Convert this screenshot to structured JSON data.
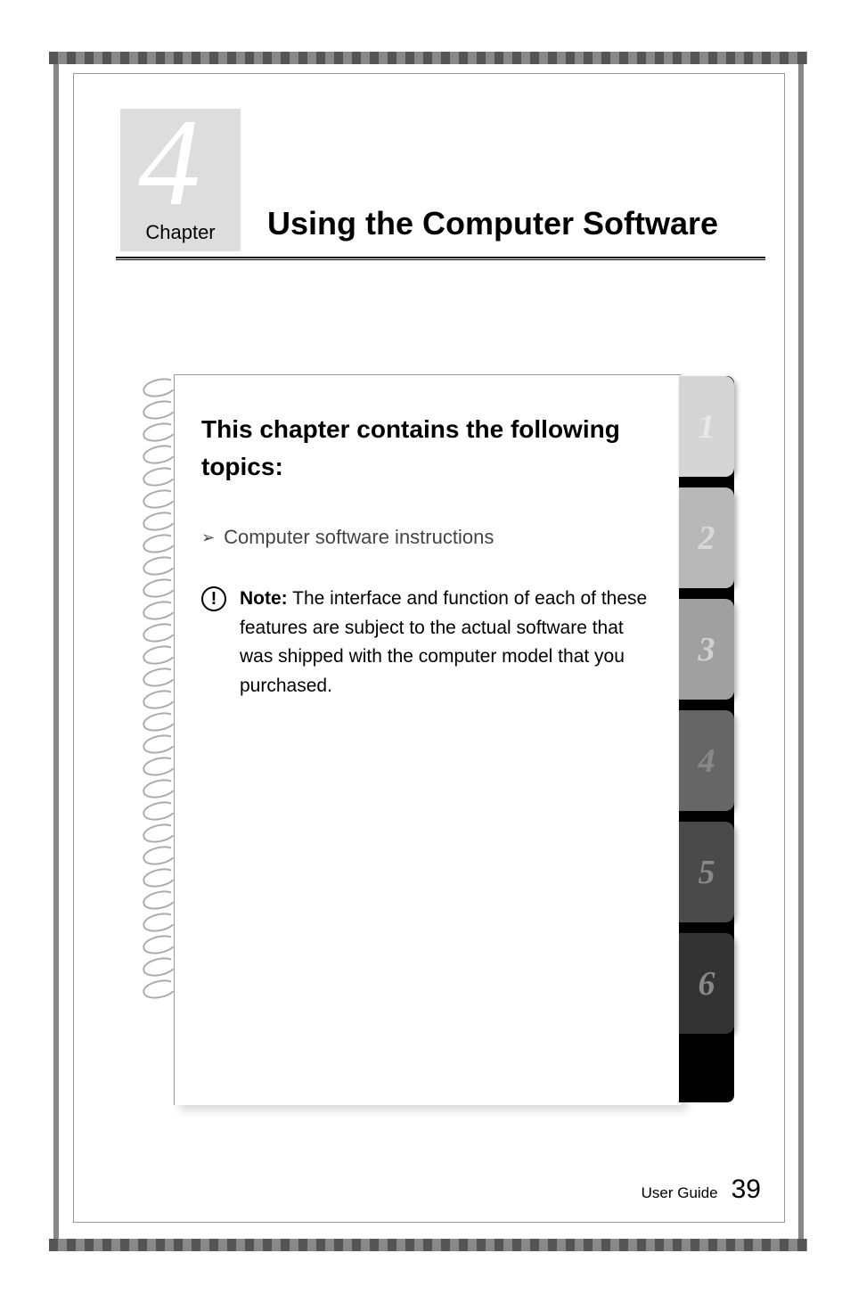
{
  "chapter": {
    "number": "4",
    "label": "Chapter",
    "title": "Using the Computer Software"
  },
  "content": {
    "heading": "This chapter contains the following topics:",
    "bullet_item": "Computer software instructions",
    "note": {
      "label": "Note:",
      "text": " The interface and function of each of these features are subject to the actual software that was shipped with the computer model that you purchased."
    }
  },
  "tabs": [
    "1",
    "2",
    "3",
    "4",
    "5",
    "6"
  ],
  "footer": {
    "label": "User Guide",
    "page": "39"
  }
}
